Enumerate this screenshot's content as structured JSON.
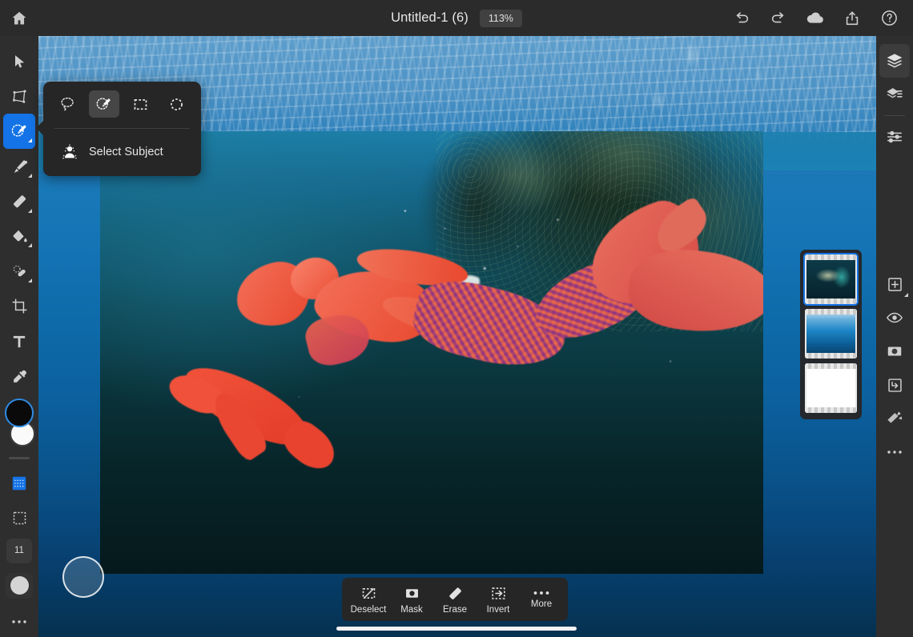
{
  "app": {
    "name": "Photoshop on iPad",
    "accent_color": "#1473e6",
    "panel_color": "#262626",
    "selection_overlay_color": "#f1513c"
  },
  "topbar": {
    "home_label": "Home",
    "document_title": "Untitled-1 (6)",
    "zoom_level": "113%",
    "actions": [
      {
        "name": "undo",
        "label": "Undo"
      },
      {
        "name": "redo",
        "label": "Redo"
      },
      {
        "name": "cloud",
        "label": "Cloud documents"
      },
      {
        "name": "share",
        "label": "Share"
      },
      {
        "name": "help",
        "label": "Help"
      }
    ]
  },
  "left_toolbar": {
    "tools": [
      {
        "name": "move",
        "label": "Move",
        "active": false,
        "has_flyout": false
      },
      {
        "name": "transform",
        "label": "Transform",
        "active": false,
        "has_flyout": false
      },
      {
        "name": "quick-select",
        "label": "Selection tools",
        "active": true,
        "has_flyout": true
      },
      {
        "name": "brush",
        "label": "Brush",
        "active": false,
        "has_flyout": true
      },
      {
        "name": "eraser",
        "label": "Eraser",
        "active": false,
        "has_flyout": true
      },
      {
        "name": "fill",
        "label": "Fill / Gradient",
        "active": false,
        "has_flyout": true
      },
      {
        "name": "healing-brush",
        "label": "Healing brush",
        "active": false,
        "has_flyout": true
      },
      {
        "name": "crop",
        "label": "Crop",
        "active": false,
        "has_flyout": false
      },
      {
        "name": "type",
        "label": "Type",
        "active": false,
        "has_flyout": false
      },
      {
        "name": "eyedropper",
        "label": "Eyedropper",
        "active": false,
        "has_flyout": false
      }
    ],
    "swatches": {
      "foreground_color": "#0a0a0a",
      "background_color": "#fafafa",
      "label": "Foreground and background colors"
    },
    "selection_tools": [
      {
        "name": "selection-overlay",
        "label": "Selection overlay",
        "active": true
      },
      {
        "name": "transform-selection",
        "label": "Transform selection",
        "active": false
      }
    ],
    "brush_size_badge": "11",
    "brush_preview_label": "Brush settings",
    "more_label": "More tools"
  },
  "tool_popover": {
    "tools": [
      {
        "name": "lasso",
        "label": "Lasso",
        "active": false
      },
      {
        "name": "quick-select-brush",
        "label": "Quick select",
        "active": true
      },
      {
        "name": "rectangular-marquee",
        "label": "Rectangular marquee",
        "active": false
      },
      {
        "name": "elliptical-marquee",
        "label": "Elliptical marquee",
        "active": false
      }
    ],
    "select_subject_label": "Select Subject"
  },
  "right_toolbar": {
    "panels": [
      {
        "name": "layers",
        "label": "Layers",
        "active": true
      },
      {
        "name": "layer-properties",
        "label": "Layer properties",
        "active": false
      },
      {
        "name": "adjustments",
        "label": "Adjustments",
        "active": false
      }
    ],
    "actions": [
      {
        "name": "add-layer",
        "label": "Add layer",
        "has_flyout": true
      },
      {
        "name": "layer-visibility",
        "label": "Show / hide layer",
        "has_flyout": false
      },
      {
        "name": "layer-mask",
        "label": "Add layer mask",
        "has_flyout": false
      },
      {
        "name": "clipping-mask",
        "label": "Clipping mask",
        "has_flyout": false
      },
      {
        "name": "quick-actions",
        "label": "Quick actions",
        "has_flyout": false
      },
      {
        "name": "layer-more",
        "label": "More",
        "has_flyout": false
      }
    ]
  },
  "layers_panel": {
    "label": "Layers",
    "layers": [
      {
        "name": "layer-mermaid",
        "label": "Mermaid photo layer",
        "selected": true,
        "thumb": "thumb-a"
      },
      {
        "name": "layer-ocean",
        "label": "Ocean background layer",
        "selected": false,
        "thumb": "thumb-b"
      },
      {
        "name": "layer-blank",
        "label": "Blank white layer",
        "selected": false,
        "thumb": "thumb-c"
      }
    ]
  },
  "action_bar": {
    "actions": [
      {
        "name": "deselect",
        "label": "Deselect"
      },
      {
        "name": "mask",
        "label": "Mask"
      },
      {
        "name": "erase",
        "label": "Erase"
      },
      {
        "name": "invert",
        "label": "Invert"
      },
      {
        "name": "more",
        "label": "More"
      }
    ]
  },
  "canvas": {
    "label": "Document canvas",
    "brush_cursor_label": "Brush size cursor",
    "image_label": "Underwater mermaid photo with active red selection overlay"
  }
}
